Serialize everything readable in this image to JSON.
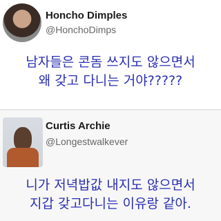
{
  "tweets": [
    {
      "display_name": "Honcho Dimples",
      "handle": "@HonchoDimps",
      "text_lines": [
        "남자들은 콘돔 쓰지도 않으면서",
        "왜 갖고 다니는 거야?????"
      ]
    },
    {
      "display_name": "Curtis Archie",
      "handle": "@Longestwalkever",
      "text_lines": [
        "니가 저녁밥값 내지도 않으면서",
        "지갑 갖고다니는 이유랑 같아."
      ]
    }
  ],
  "colors": {
    "tweet_text": "#2a2fb0",
    "name": "#1a1a1a",
    "handle": "#666666"
  }
}
